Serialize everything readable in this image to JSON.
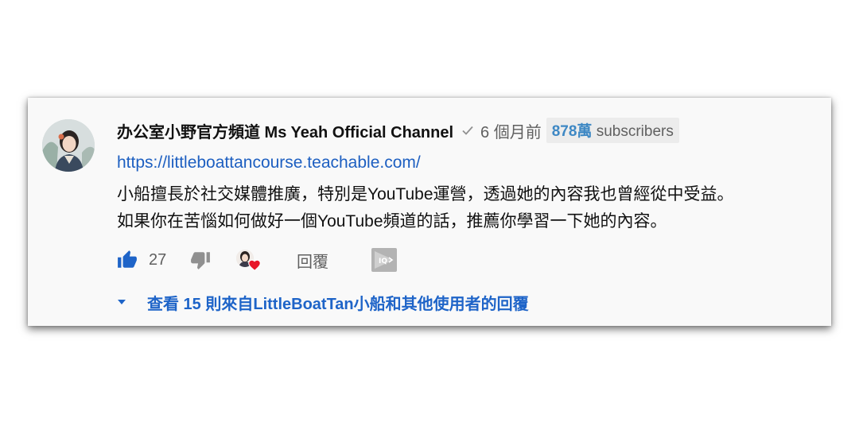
{
  "comment": {
    "author": "办公室小野官方頻道 Ms Yeah Official Channel",
    "time": "6 個月前",
    "subscriber_count": "878萬",
    "subscriber_label": "subscribers",
    "link": "https://littleboattancourse.teachable.com/",
    "text_line1": "小船擅長於社交媒體推廣，特別是YouTube運營，透過她的內容我也曾經從中受益。",
    "text_line2": "如果你在苦惱如何做好一個YouTube頻道的話，推薦你學習一下她的內容。",
    "verified": true
  },
  "actions": {
    "like_count": "27",
    "reply_label": "回覆",
    "creator_hearted": true
  },
  "replies": {
    "label": "查看 15 則來自LittleBoatTan小船和其他使用者的回覆"
  },
  "colors": {
    "link": "#1d5fc1",
    "accent_blue": "#1e64c8",
    "heart": "#e8162a",
    "like_blue": "#1e64c8",
    "text_secondary": "#606060"
  },
  "icons": {
    "verified": "check-icon",
    "like": "thumbs-up-icon",
    "dislike": "thumbs-down-icon",
    "creator_heart": "heart-icon",
    "expand": "caret-down-icon",
    "extension": "extension-icon"
  }
}
